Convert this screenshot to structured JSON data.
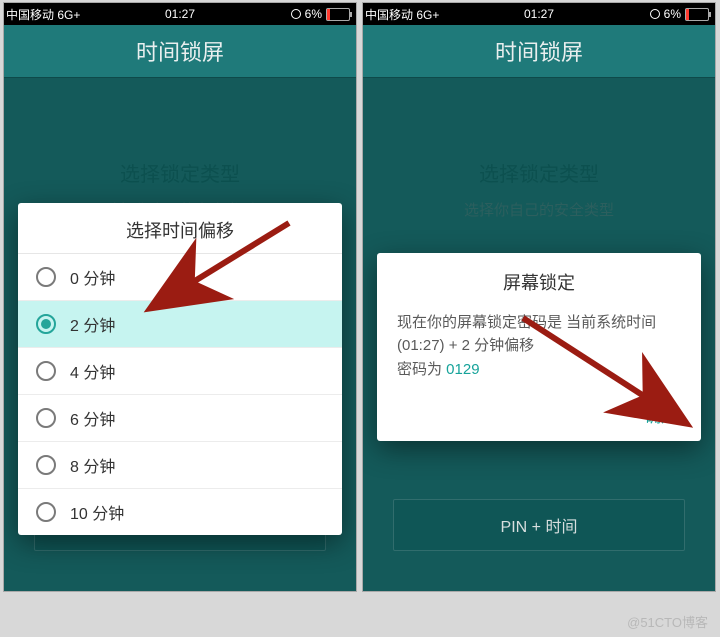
{
  "status": {
    "carrier": "中国移动 6G+",
    "time": "01:27",
    "battery_text": "6%"
  },
  "app": {
    "header_title": "时间锁屏"
  },
  "background": {
    "title": "选择锁定类型",
    "subtitle": "选择你自己的安全类型",
    "pin_button": "PIN + 时间"
  },
  "left_dialog": {
    "title": "选择时间偏移",
    "options": [
      {
        "label": "0 分钟",
        "selected": false
      },
      {
        "label": "2 分钟",
        "selected": true
      },
      {
        "label": "4 分钟",
        "selected": false
      },
      {
        "label": "6 分钟",
        "selected": false
      },
      {
        "label": "8 分钟",
        "selected": false
      },
      {
        "label": "10 分钟",
        "selected": false
      }
    ]
  },
  "right_dialog": {
    "title": "屏幕锁定",
    "body_prefix": "现在你的屏幕锁定密码是 当前系统时间 (01:27) + 2 分钟偏移",
    "body_pwd_label": "密码为 ",
    "body_pwd_code": "0129",
    "confirm": "确定"
  },
  "watermark": "@51CTO博客"
}
